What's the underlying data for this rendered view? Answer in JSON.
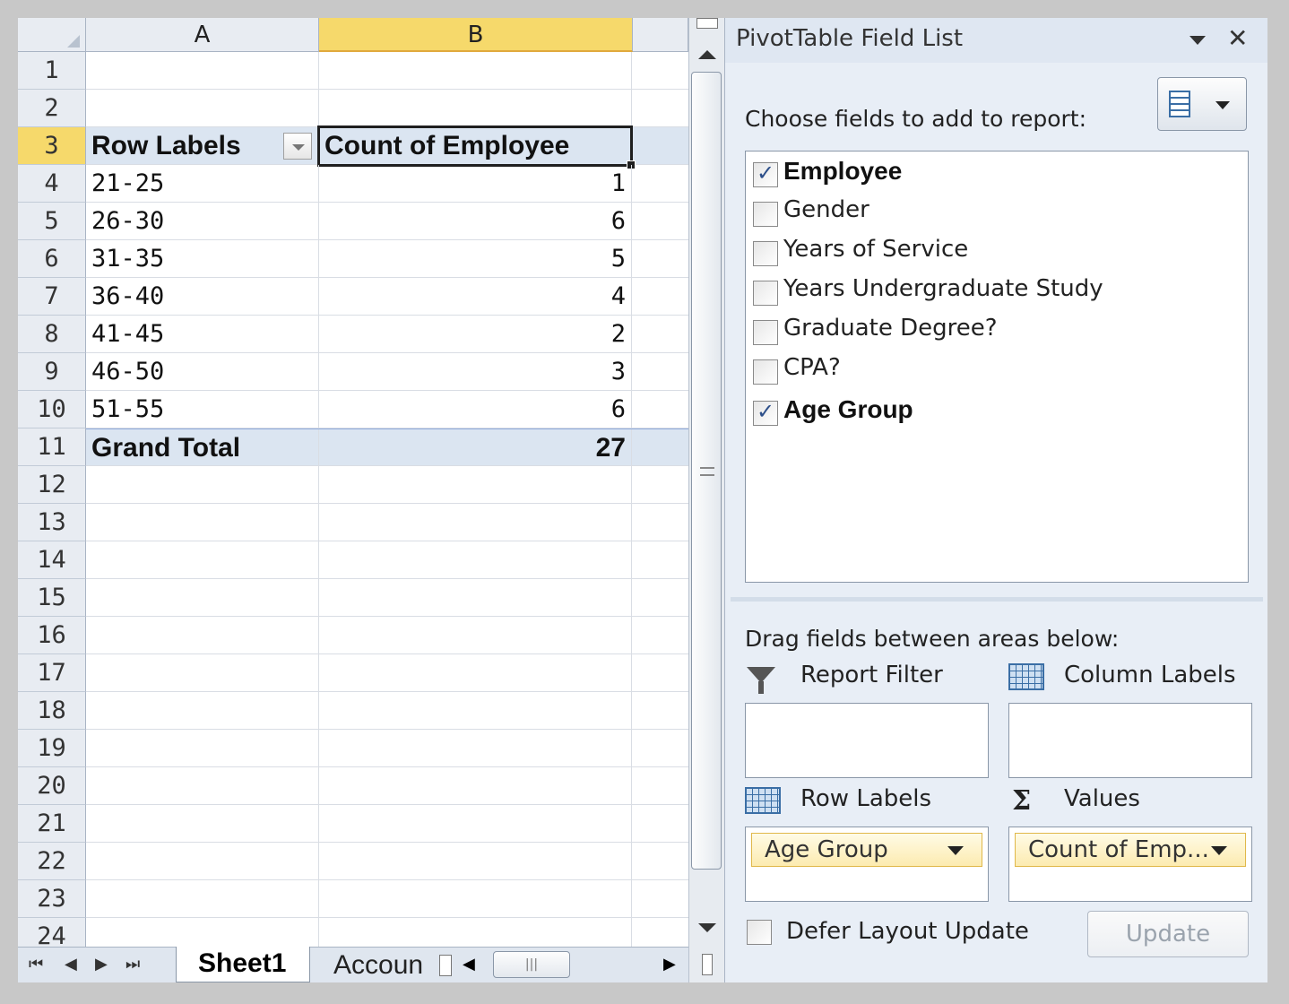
{
  "sheet": {
    "columns": [
      "A",
      "B"
    ],
    "row_numbers": [
      "1",
      "2",
      "3",
      "4",
      "5",
      "6",
      "7",
      "8",
      "9",
      "10",
      "11",
      "12",
      "13",
      "14",
      "15",
      "16",
      "17",
      "18",
      "19",
      "20",
      "21",
      "22",
      "23",
      "24"
    ],
    "pivot": {
      "header_row_label": "Row Labels",
      "header_value": "Count of Employee",
      "rows": [
        {
          "label": "21-25",
          "value": "1"
        },
        {
          "label": "26-30",
          "value": "6"
        },
        {
          "label": "31-35",
          "value": "5"
        },
        {
          "label": "36-40",
          "value": "4"
        },
        {
          "label": "41-45",
          "value": "2"
        },
        {
          "label": "46-50",
          "value": "3"
        },
        {
          "label": "51-55",
          "value": "6"
        }
      ],
      "total_label": "Grand Total",
      "total_value": "27"
    },
    "tabs": [
      "Sheet1",
      "Accoun"
    ]
  },
  "panel": {
    "title": "PivotTable Field List",
    "choose_label": "Choose fields to add to report:",
    "fields": [
      {
        "label": "Employee",
        "checked": true
      },
      {
        "label": "Gender",
        "checked": false
      },
      {
        "label": "Years of Service",
        "checked": false
      },
      {
        "label": "Years Undergraduate Study",
        "checked": false
      },
      {
        "label": "Graduate Degree?",
        "checked": false
      },
      {
        "label": "CPA?",
        "checked": false
      },
      {
        "label": "Age Group",
        "checked": true
      }
    ],
    "drag_label": "Drag fields between areas below:",
    "areas": {
      "report_filter": "Report Filter",
      "column_labels": "Column Labels",
      "row_labels": "Row Labels",
      "values": "Values",
      "row_chip": "Age Group",
      "value_chip": "Count of Emp..."
    },
    "defer_label": "Defer Layout Update",
    "update_label": "Update"
  },
  "icons": {
    "close": "close-icon",
    "dropdown": "chevron-down-icon",
    "filter": "filter-icon",
    "grid": "grid-icon",
    "sigma": "sigma-icon"
  }
}
